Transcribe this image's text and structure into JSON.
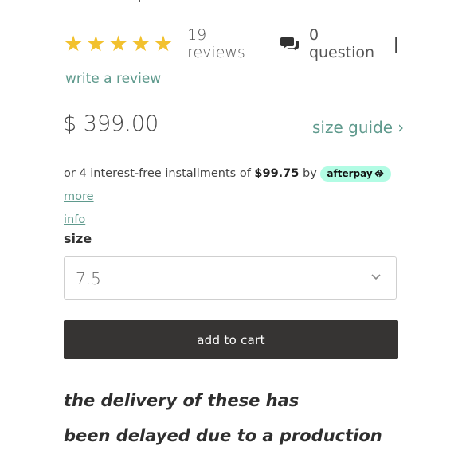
{
  "rating": {
    "stars": 5,
    "reviews_text": "19 reviews",
    "questions_text": "0 question",
    "divider": "|",
    "star_color": "#f2c12e"
  },
  "write_review": "write a review",
  "price": "$ 399.00",
  "size_guide": {
    "label": "size guide",
    "chevron": "›"
  },
  "installments": {
    "prefix": "or 4 interest-free installments of",
    "amount": "$99.75",
    "by": "by",
    "badge": "afterpay",
    "more": "more",
    "info": "info"
  },
  "size": {
    "label": "size",
    "value": "7.5"
  },
  "cart": {
    "label": "add to cart"
  },
  "notice": {
    "lines": [
      "the delivery of these has",
      "been delayed due to a production"
    ]
  },
  "colors": {
    "accent": "#5f9a8d",
    "button_bg": "#363433",
    "afterpay_bg": "#b2fce4"
  }
}
